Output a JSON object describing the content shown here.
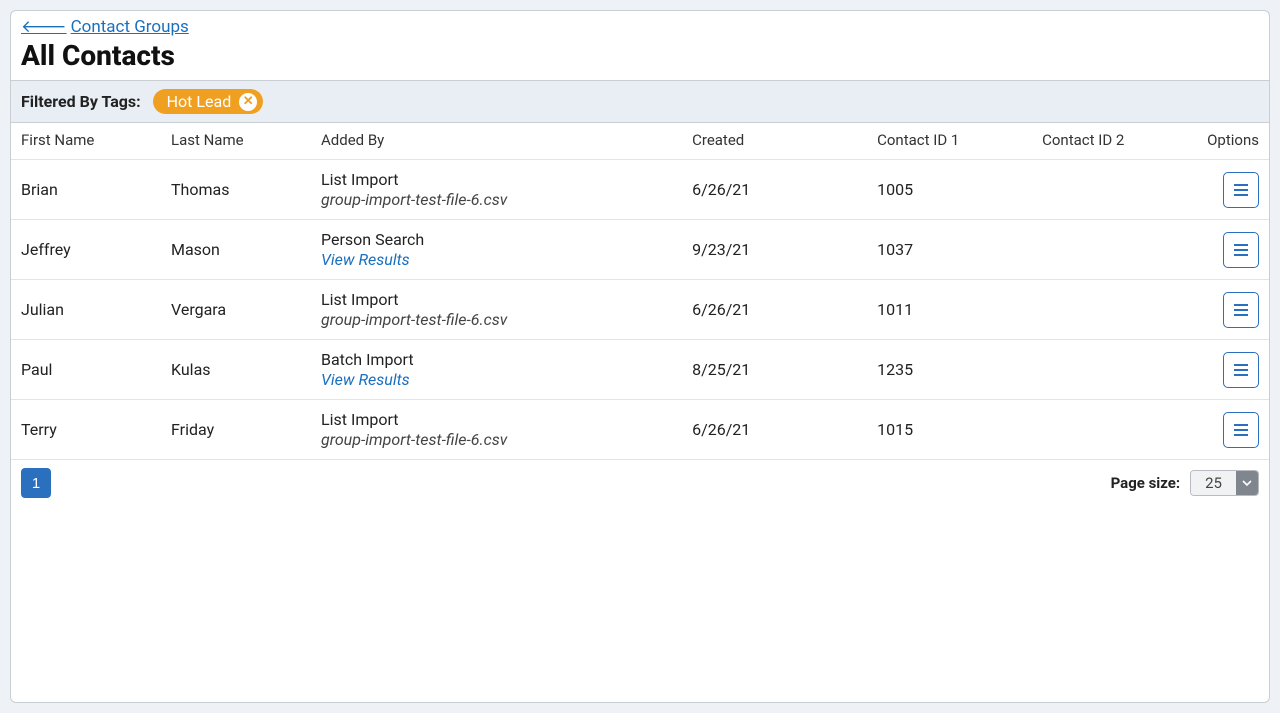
{
  "header": {
    "back_label": "Contact Groups",
    "title": "All Contacts"
  },
  "filter": {
    "label": "Filtered By Tags:",
    "tag": "Hot Lead"
  },
  "columns": {
    "first_name": "First Name",
    "last_name": "Last Name",
    "added_by": "Added By",
    "created": "Created",
    "contact_id1": "Contact ID 1",
    "contact_id2": "Contact ID 2",
    "options": "Options"
  },
  "rows": [
    {
      "first_name": "Brian",
      "last_name": "Thomas",
      "added_by": "List Import",
      "added_by_sub": "group-import-test-file-6.csv",
      "sub_is_link": false,
      "created": "6/26/21",
      "contact_id1": "1005",
      "contact_id2": ""
    },
    {
      "first_name": "Jeffrey",
      "last_name": "Mason",
      "added_by": "Person Search",
      "added_by_sub": "View Results",
      "sub_is_link": true,
      "created": "9/23/21",
      "contact_id1": "1037",
      "contact_id2": ""
    },
    {
      "first_name": "Julian",
      "last_name": "Vergara",
      "added_by": "List Import",
      "added_by_sub": "group-import-test-file-6.csv",
      "sub_is_link": false,
      "created": "6/26/21",
      "contact_id1": "1011",
      "contact_id2": ""
    },
    {
      "first_name": "Paul",
      "last_name": "Kulas",
      "added_by": "Batch Import",
      "added_by_sub": "View Results",
      "sub_is_link": true,
      "created": "8/25/21",
      "contact_id1": "1235",
      "contact_id2": ""
    },
    {
      "first_name": "Terry",
      "last_name": "Friday",
      "added_by": "List Import",
      "added_by_sub": "group-import-test-file-6.csv",
      "sub_is_link": false,
      "created": "6/26/21",
      "contact_id1": "1015",
      "contact_id2": ""
    }
  ],
  "pager": {
    "page": "1",
    "page_size_label": "Page size:",
    "page_size_value": "25"
  }
}
